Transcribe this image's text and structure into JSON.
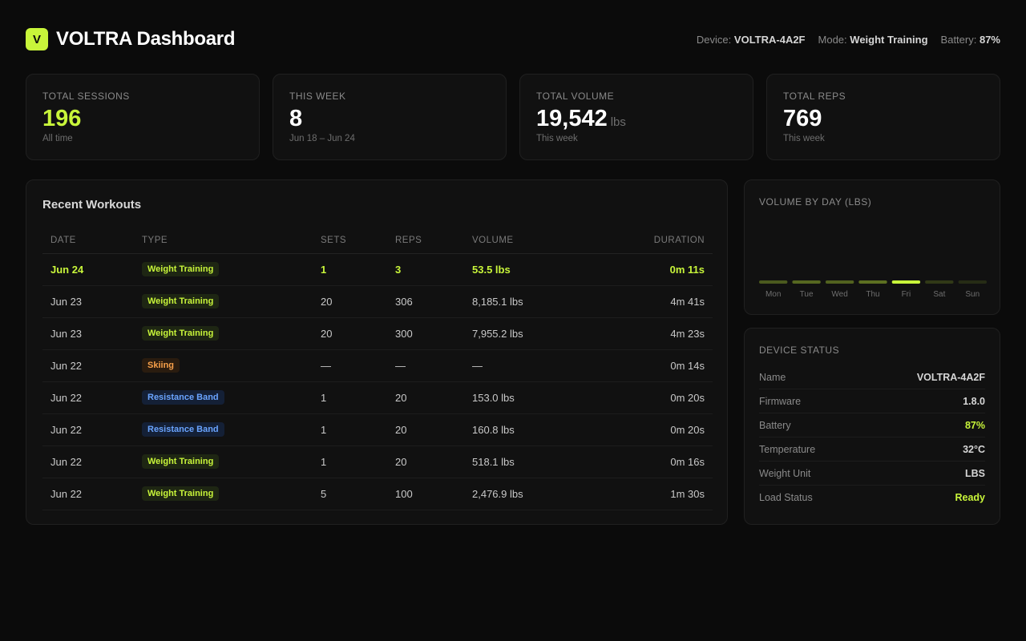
{
  "header": {
    "logo_letter": "V",
    "title": "VOLTRA Dashboard",
    "device_label": "Device:",
    "device_value": "VOLTRA-4A2F",
    "mode_label": "Mode:",
    "mode_value": "Weight Training",
    "battery_label": "Battery:",
    "battery_value": "87%"
  },
  "stats": [
    {
      "label": "Total Sessions",
      "value": "196",
      "unit": "",
      "sub": "All time"
    },
    {
      "label": "This Week",
      "value": "8",
      "unit": "",
      "sub": "Jun 18 – Jun 24"
    },
    {
      "label": "Total Volume",
      "value": "19,542",
      "unit": "lbs",
      "sub": "This week"
    },
    {
      "label": "Total Reps",
      "value": "769",
      "unit": "",
      "sub": "This week"
    }
  ],
  "workouts": {
    "title": "Recent Workouts",
    "columns": [
      "DATE",
      "TYPE",
      "SETS",
      "REPS",
      "VOLUME",
      "DURATION"
    ],
    "rows": [
      {
        "date": "Jun 24",
        "type": "Weight Training",
        "sets": "1",
        "reps": "3",
        "volume": "53.5 lbs",
        "duration": "0m 11s"
      },
      {
        "date": "Jun 23",
        "type": "Weight Training",
        "sets": "20",
        "reps": "306",
        "volume": "8,185.1 lbs",
        "duration": "4m 41s"
      },
      {
        "date": "Jun 23",
        "type": "Weight Training",
        "sets": "20",
        "reps": "300",
        "volume": "7,955.2 lbs",
        "duration": "4m 23s"
      },
      {
        "date": "Jun 22",
        "type": "Skiing",
        "sets": "—",
        "reps": "—",
        "volume": "—",
        "duration": "0m 14s"
      },
      {
        "date": "Jun 22",
        "type": "Resistance Band",
        "sets": "1",
        "reps": "20",
        "volume": "153.0 lbs",
        "duration": "0m 20s"
      },
      {
        "date": "Jun 22",
        "type": "Resistance Band",
        "sets": "1",
        "reps": "20",
        "volume": "160.8 lbs",
        "duration": "0m 20s"
      },
      {
        "date": "Jun 22",
        "type": "Weight Training",
        "sets": "1",
        "reps": "20",
        "volume": "518.1 lbs",
        "duration": "0m 16s"
      },
      {
        "date": "Jun 22",
        "type": "Weight Training",
        "sets": "5",
        "reps": "100",
        "volume": "2,476.9 lbs",
        "duration": "1m 30s"
      }
    ]
  },
  "volume_chart": {
    "title": "Volume by Day (lbs)"
  },
  "chart_data": {
    "type": "bar",
    "title": "VOLUME BY DAY (LBS)",
    "categories": [
      "Mon",
      "Tue",
      "Wed",
      "Thu",
      "Fri",
      "Sat",
      "Sun"
    ],
    "values": [
      0,
      0,
      0,
      0,
      0,
      0,
      0
    ],
    "highlight": "Fri",
    "bar_color": "#c8f53a"
  },
  "device_status": {
    "title": "Device Status",
    "rows": [
      {
        "key": "Name",
        "value": "VOLTRA-4A2F"
      },
      {
        "key": "Firmware",
        "value": "1.8.0"
      },
      {
        "key": "Battery",
        "value": "87%"
      },
      {
        "key": "Temperature",
        "value": "32°C"
      },
      {
        "key": "Weight Unit",
        "value": "LBS"
      },
      {
        "key": "Load Status",
        "value": "Ready"
      }
    ]
  },
  "colors": {
    "accent": "#c8f53a",
    "background": "#0b0b0b",
    "card": "#111111",
    "skiing": "#f7a04a",
    "band": "#6aa4ff"
  }
}
